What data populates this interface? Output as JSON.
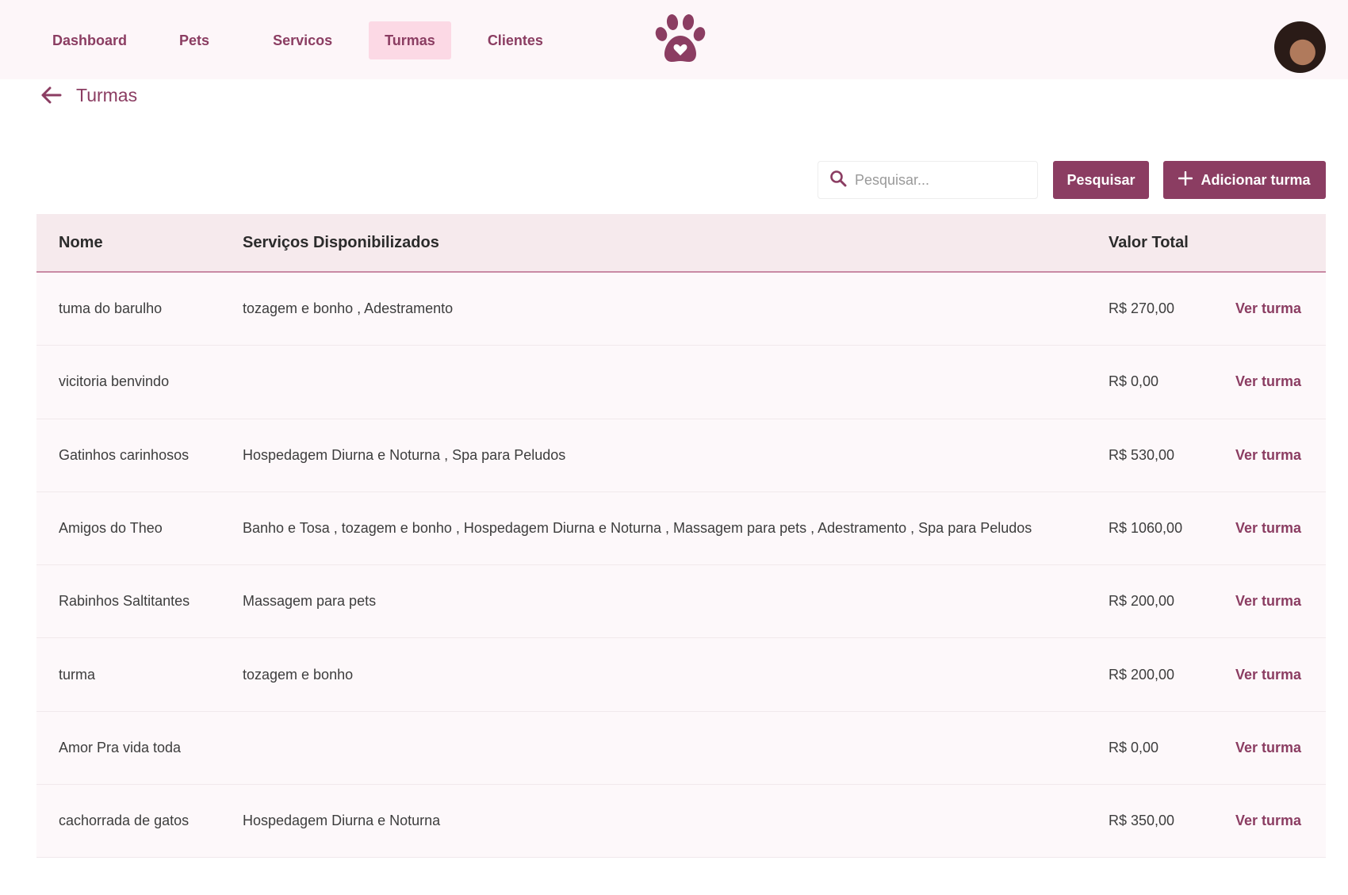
{
  "nav": {
    "items": [
      {
        "label": "Dashboard"
      },
      {
        "label": "Pets"
      },
      {
        "label": "Servicos"
      },
      {
        "label": "Turmas"
      },
      {
        "label": "Clientes"
      }
    ],
    "active": "Turmas"
  },
  "icons": {
    "logo": "paw-heart-icon",
    "back": "arrow-left-icon",
    "search": "search-icon",
    "add": "plus-icon"
  },
  "colors": {
    "accent": "#8b3d62",
    "active_tab_bg": "#fcd9e5",
    "header_bg": "#f6eaed"
  },
  "page": {
    "title": "Turmas"
  },
  "search": {
    "placeholder": "Pesquisar...",
    "value": ""
  },
  "buttons": {
    "search": "Pesquisar",
    "add": "Adicionar turma"
  },
  "table": {
    "headers": {
      "name": "Nome",
      "services": "Serviços Disponibilizados",
      "total": "Valor Total"
    },
    "action_label": "Ver turma",
    "rows": [
      {
        "name": "tuma do barulho",
        "services": "tozagem e bonho , Adestramento",
        "total": "R$ 270,00"
      },
      {
        "name": "vicitoria benvindo",
        "services": "",
        "total": "R$ 0,00"
      },
      {
        "name": "Gatinhos carinhosos",
        "services": "Hospedagem Diurna e Noturna , Spa para Peludos",
        "total": "R$ 530,00"
      },
      {
        "name": "Amigos do Theo",
        "services": "Banho e Tosa , tozagem e bonho , Hospedagem Diurna e Noturna , Massagem para pets , Adestramento , Spa para Peludos",
        "total": "R$ 1060,00"
      },
      {
        "name": "Rabinhos Saltitantes",
        "services": "Massagem para pets",
        "total": "R$ 200,00"
      },
      {
        "name": "turma",
        "services": "tozagem e bonho",
        "total": "R$ 200,00"
      },
      {
        "name": "Amor Pra vida toda",
        "services": "",
        "total": "R$ 0,00"
      },
      {
        "name": "cachorrada de gatos",
        "services": "Hospedagem Diurna e Noturna",
        "total": "R$ 350,00"
      }
    ]
  }
}
